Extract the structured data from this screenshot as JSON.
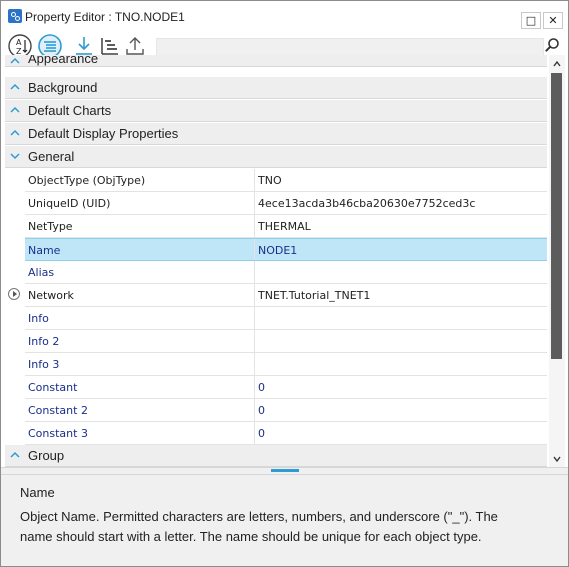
{
  "window": {
    "title": "Property Editor : TNO.NODE1",
    "minimize_label": "□",
    "close_label": "✕"
  },
  "toolbar": {
    "search_placeholder": "",
    "icons": [
      "sort-alphabetical-icon",
      "sort-categorized-icon",
      "download-icon",
      "list-indent-icon",
      "upload-icon",
      "search-icon"
    ]
  },
  "categories": {
    "appearance": "Appearance",
    "background": "Background",
    "default_charts": "Default Charts",
    "default_display": "Default Display Properties",
    "general": "General",
    "group": "Group"
  },
  "properties": [
    {
      "name": "ObjectType (ObjType)",
      "value": "TNO",
      "style": "dark"
    },
    {
      "name": "UniqueID (UID)",
      "value": "4ece13acda3b46cba20630e7752ced3c",
      "style": "dark"
    },
    {
      "name": "NetType",
      "value": "THERMAL",
      "style": "dark"
    },
    {
      "name": "Name",
      "value": "NODE1",
      "style": "blue"
    },
    {
      "name": "Alias",
      "value": "",
      "style": "blue"
    },
    {
      "name": "Network",
      "value": "TNET.Tutorial_TNET1",
      "style": "dark"
    },
    {
      "name": "Info",
      "value": "",
      "style": "blue"
    },
    {
      "name": "Info 2",
      "value": "",
      "style": "blue"
    },
    {
      "name": "Info 3",
      "value": "",
      "style": "blue"
    },
    {
      "name": "Constant",
      "value": "0",
      "style": "blue"
    },
    {
      "name": "Constant 2",
      "value": "0",
      "style": "blue"
    },
    {
      "name": "Constant 3",
      "value": "0",
      "style": "blue"
    }
  ],
  "description": {
    "heading": "Name",
    "text": "Object Name. Permitted characters are letters, numbers, and underscore (\"_\"). The name should start with a letter. The name should be unique for each object type."
  },
  "colors": {
    "selection": "#bfe6f6",
    "category_bg": "#eeeeee",
    "accent": "#2e9bd6",
    "editable_text": "#1a2f8a"
  }
}
